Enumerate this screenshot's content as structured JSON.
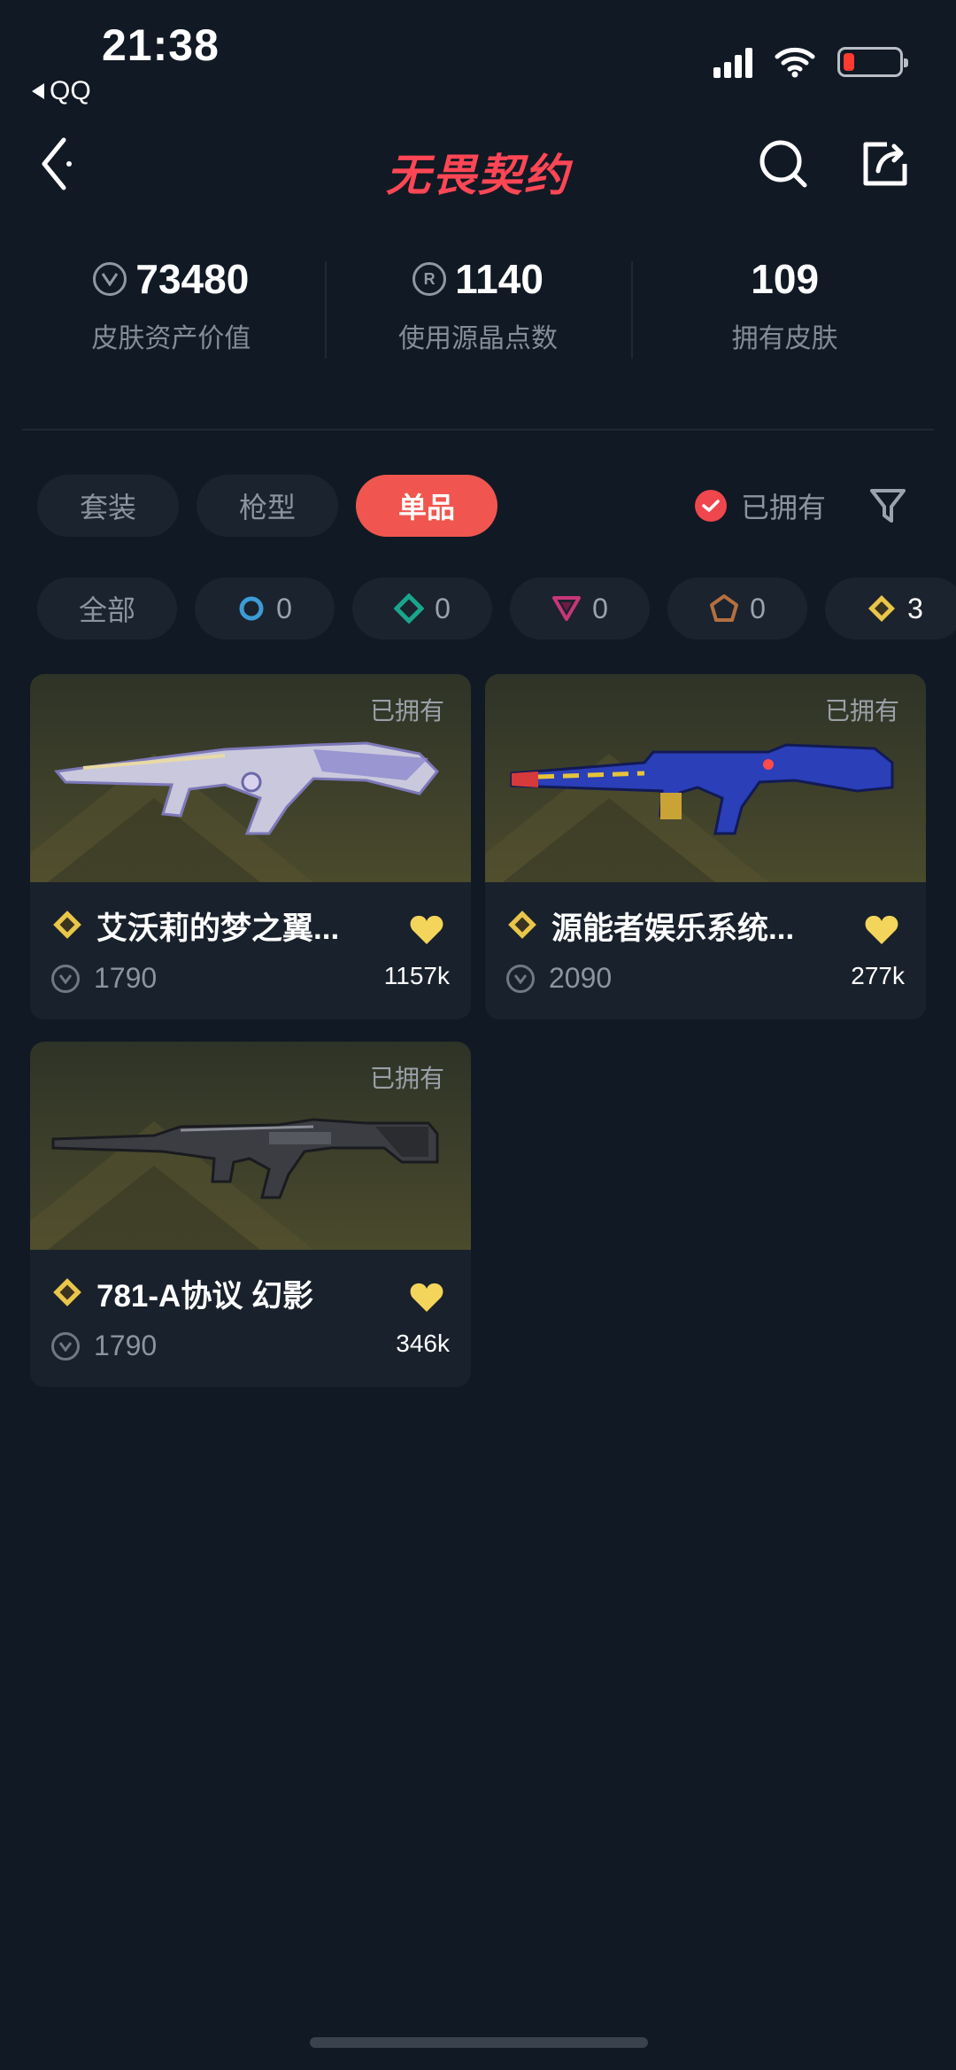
{
  "status_bar": {
    "time": "21:38",
    "back_app": "QQ",
    "battery_percent": 20
  },
  "header": {
    "logo": "无畏契约"
  },
  "stats": [
    {
      "value": "73480",
      "label": "皮肤资产价值",
      "icon": "vp-coin-icon"
    },
    {
      "value": "1140",
      "label": "使用源晶点数",
      "icon": "radianite-icon"
    },
    {
      "value": "109",
      "label": "拥有皮肤",
      "icon": ""
    }
  ],
  "tabs": [
    {
      "label": "套装",
      "active": false
    },
    {
      "label": "枪型",
      "active": false
    },
    {
      "label": "单品",
      "active": true
    }
  ],
  "owned_filter": {
    "label": "已拥有",
    "checked": true
  },
  "rarity_chips": [
    {
      "label": "全部",
      "count": ""
    },
    {
      "icon": "select-tier-icon",
      "count": "0",
      "color": "#3d9bd6"
    },
    {
      "icon": "deluxe-tier-icon",
      "count": "0",
      "color": "#1aa58c"
    },
    {
      "icon": "premium-tier-icon",
      "count": "0",
      "color": "#c9367a"
    },
    {
      "icon": "ultra-tier-icon",
      "count": "0",
      "color": "#b3703e"
    },
    {
      "icon": "exclusive-tier-icon",
      "count": "3",
      "color": "#e9c54a"
    }
  ],
  "cards": [
    {
      "name": "艾沃莉的梦之翼...",
      "price": "1790",
      "likes": "1157k",
      "owned": "已拥有"
    },
    {
      "name": "源能者娱乐系统...",
      "price": "2090",
      "likes": "277k",
      "owned": "已拥有"
    },
    {
      "name": "781-A协议 幻影",
      "price": "1790",
      "likes": "346k",
      "owned": "已拥有"
    }
  ],
  "colors": {
    "accent": "#f0564f",
    "background": "#111924",
    "heart": "#f3d55b"
  }
}
